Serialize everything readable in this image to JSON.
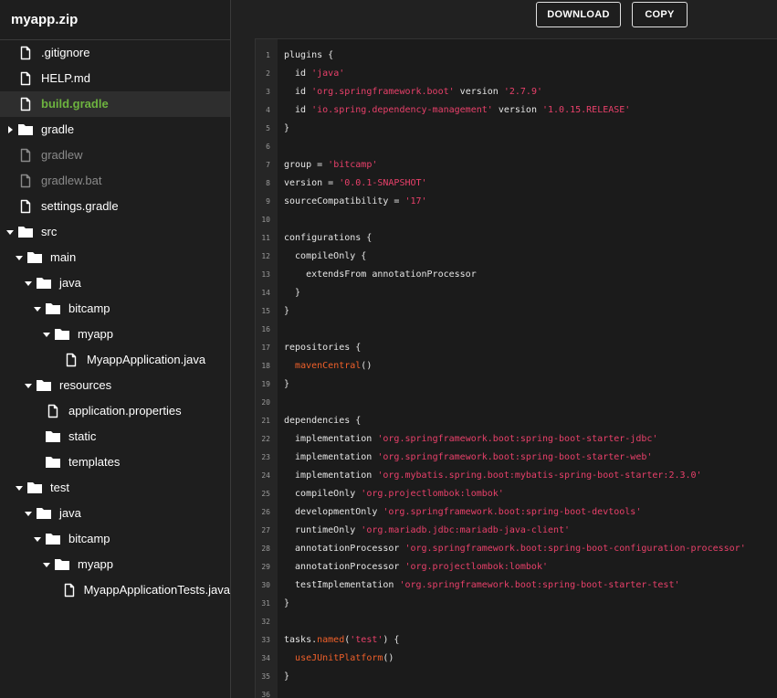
{
  "sidebar": {
    "title": "myapp.zip",
    "tree": [
      {
        "label": ".gitignore",
        "type": "file",
        "depth": 0,
        "state": "normal"
      },
      {
        "label": "HELP.md",
        "type": "file",
        "depth": 0,
        "state": "normal"
      },
      {
        "label": "build.gradle",
        "type": "file",
        "depth": 0,
        "state": "selected"
      },
      {
        "label": "gradle",
        "type": "folder",
        "depth": 0,
        "caret": "right",
        "state": "normal"
      },
      {
        "label": "gradlew",
        "type": "file",
        "depth": 0,
        "state": "dim"
      },
      {
        "label": "gradlew.bat",
        "type": "file",
        "depth": 0,
        "state": "dim"
      },
      {
        "label": "settings.gradle",
        "type": "file",
        "depth": 0,
        "state": "normal"
      },
      {
        "label": "src",
        "type": "folder",
        "depth": 0,
        "caret": "down",
        "state": "normal"
      },
      {
        "label": "main",
        "type": "folder",
        "depth": 1,
        "caret": "down",
        "state": "normal"
      },
      {
        "label": "java",
        "type": "folder",
        "depth": 2,
        "caret": "down",
        "state": "normal"
      },
      {
        "label": "bitcamp",
        "type": "folder",
        "depth": 3,
        "caret": "down",
        "state": "normal"
      },
      {
        "label": "myapp",
        "type": "folder",
        "depth": 4,
        "caret": "down",
        "state": "normal"
      },
      {
        "label": "MyappApplication.java",
        "type": "file",
        "depth": 5,
        "state": "normal"
      },
      {
        "label": "resources",
        "type": "folder",
        "depth": 2,
        "caret": "down",
        "state": "normal"
      },
      {
        "label": "application.properties",
        "type": "file",
        "depth": 3,
        "state": "normal"
      },
      {
        "label": "static",
        "type": "folder",
        "depth": 3,
        "caret": "none",
        "state": "normal"
      },
      {
        "label": "templates",
        "type": "folder",
        "depth": 3,
        "caret": "none",
        "state": "normal"
      },
      {
        "label": "test",
        "type": "folder",
        "depth": 1,
        "caret": "down",
        "state": "normal"
      },
      {
        "label": "java",
        "type": "folder",
        "depth": 2,
        "caret": "down",
        "state": "normal"
      },
      {
        "label": "bitcamp",
        "type": "folder",
        "depth": 3,
        "caret": "down",
        "state": "normal"
      },
      {
        "label": "myapp",
        "type": "folder",
        "depth": 4,
        "caret": "down",
        "state": "normal"
      },
      {
        "label": "MyappApplicationTests.java",
        "type": "file",
        "depth": 5,
        "state": "normal"
      }
    ]
  },
  "toolbar": {
    "download_label": "DOWNLOAD",
    "copy_label": "COPY"
  },
  "editor": {
    "lines": [
      [
        {
          "t": "plugins {"
        }
      ],
      [
        {
          "t": "  id "
        },
        {
          "t": "'java'",
          "c": "str"
        }
      ],
      [
        {
          "t": "  id "
        },
        {
          "t": "'org.springframework.boot'",
          "c": "str"
        },
        {
          "t": " version "
        },
        {
          "t": "'2.7.9'",
          "c": "str"
        }
      ],
      [
        {
          "t": "  id "
        },
        {
          "t": "'io.spring.dependency-management'",
          "c": "str"
        },
        {
          "t": " version "
        },
        {
          "t": "'1.0.15.RELEASE'",
          "c": "str"
        }
      ],
      [
        {
          "t": "}"
        }
      ],
      [],
      [
        {
          "t": "group = "
        },
        {
          "t": "'bitcamp'",
          "c": "str"
        }
      ],
      [
        {
          "t": "version = "
        },
        {
          "t": "'0.0.1-SNAPSHOT'",
          "c": "str"
        }
      ],
      [
        {
          "t": "sourceCompatibility = "
        },
        {
          "t": "'17'",
          "c": "str"
        }
      ],
      [],
      [
        {
          "t": "configurations {"
        }
      ],
      [
        {
          "t": "  compileOnly {"
        }
      ],
      [
        {
          "t": "    extendsFrom annotationProcessor"
        }
      ],
      [
        {
          "t": "  }"
        }
      ],
      [
        {
          "t": "}"
        }
      ],
      [],
      [
        {
          "t": "repositories {"
        }
      ],
      [
        {
          "t": "  "
        },
        {
          "t": "mavenCentral",
          "c": "fn"
        },
        {
          "t": "()"
        }
      ],
      [
        {
          "t": "}"
        }
      ],
      [],
      [
        {
          "t": "dependencies {"
        }
      ],
      [
        {
          "t": "  implementation "
        },
        {
          "t": "'org.springframework.boot:spring-boot-starter-jdbc'",
          "c": "str"
        }
      ],
      [
        {
          "t": "  implementation "
        },
        {
          "t": "'org.springframework.boot:spring-boot-starter-web'",
          "c": "str"
        }
      ],
      [
        {
          "t": "  implementation "
        },
        {
          "t": "'org.mybatis.spring.boot:mybatis-spring-boot-starter:2.3.0'",
          "c": "str"
        }
      ],
      [
        {
          "t": "  compileOnly "
        },
        {
          "t": "'org.projectlombok:lombok'",
          "c": "str"
        }
      ],
      [
        {
          "t": "  developmentOnly "
        },
        {
          "t": "'org.springframework.boot:spring-boot-devtools'",
          "c": "str"
        }
      ],
      [
        {
          "t": "  runtimeOnly "
        },
        {
          "t": "'org.mariadb.jdbc:mariadb-java-client'",
          "c": "str"
        }
      ],
      [
        {
          "t": "  annotationProcessor "
        },
        {
          "t": "'org.springframework.boot:spring-boot-configuration-processor'",
          "c": "str"
        }
      ],
      [
        {
          "t": "  annotationProcessor "
        },
        {
          "t": "'org.projectlombok:lombok'",
          "c": "str"
        }
      ],
      [
        {
          "t": "  testImplementation "
        },
        {
          "t": "'org.springframework.boot:spring-boot-starter-test'",
          "c": "str"
        }
      ],
      [
        {
          "t": "}"
        }
      ],
      [],
      [
        {
          "t": "tasks."
        },
        {
          "t": "named",
          "c": "fn"
        },
        {
          "t": "("
        },
        {
          "t": "'test'",
          "c": "str"
        },
        {
          "t": ") {"
        }
      ],
      [
        {
          "t": "  "
        },
        {
          "t": "useJUnitPlatform",
          "c": "fn"
        },
        {
          "t": "()"
        }
      ],
      [
        {
          "t": "}"
        }
      ],
      []
    ]
  },
  "colors": {
    "selected_file": "#6db33f",
    "string": "#e8406a",
    "function": "#f0602a"
  }
}
